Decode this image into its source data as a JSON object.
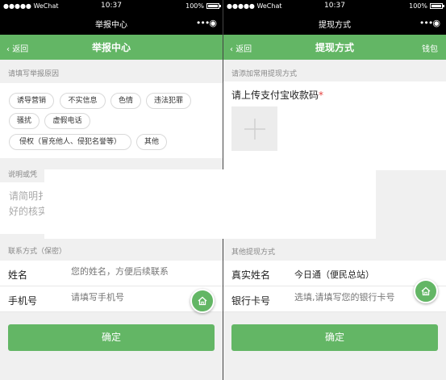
{
  "left": {
    "status": {
      "carrier": "●●●●● WeChat",
      "time": "10:37",
      "battery": "100%"
    },
    "wx_title": "举报中心",
    "nav": {
      "back": "返回",
      "title": "举报中心"
    },
    "reason_label": "请填写举报原因",
    "tags": [
      "诱导营销",
      "不实信息",
      "色情",
      "违法犯罪",
      "骚扰",
      "虚假电话",
      "侵权（冒充他人、侵犯名誉等）",
      "其他"
    ],
    "desc_label": "说明或凭",
    "desc_placeholder_line1": "请简明扌",
    "desc_placeholder_line2": "好的核实",
    "contact_label": "联系方式（保密）",
    "name_field": {
      "label": "姓名",
      "placeholder": "您的姓名，方便后续联系"
    },
    "phone_field": {
      "label": "手机号",
      "placeholder": "请填写手机号"
    },
    "confirm": "确定"
  },
  "right": {
    "status": {
      "carrier": "●●●●● WeChat",
      "time": "10:37",
      "battery": "100%"
    },
    "wx_title": "提现方式",
    "nav": {
      "back": "返回",
      "title": "提现方式",
      "right": "钱包"
    },
    "add_label": "请添加常用提现方式",
    "upload_title": "请上传支付宝收款码",
    "required_mark": "*",
    "other_label": "其他提现方式",
    "realname_field": {
      "label": "真实姓名",
      "value": "今日通（便民总站）"
    },
    "bankcard_field": {
      "label": "银行卡号",
      "placeholder": "选填,请填写您的银行卡号"
    },
    "confirm": "确定"
  },
  "colors": {
    "brand_green": "#63b665",
    "page_bg": "#f0f0f0",
    "status_bar": "#000000",
    "required_red": "#e64340"
  },
  "icons": [
    "back-chevron-icon",
    "more-dots-icon",
    "battery-icon",
    "plus-icon",
    "home-icon"
  ]
}
